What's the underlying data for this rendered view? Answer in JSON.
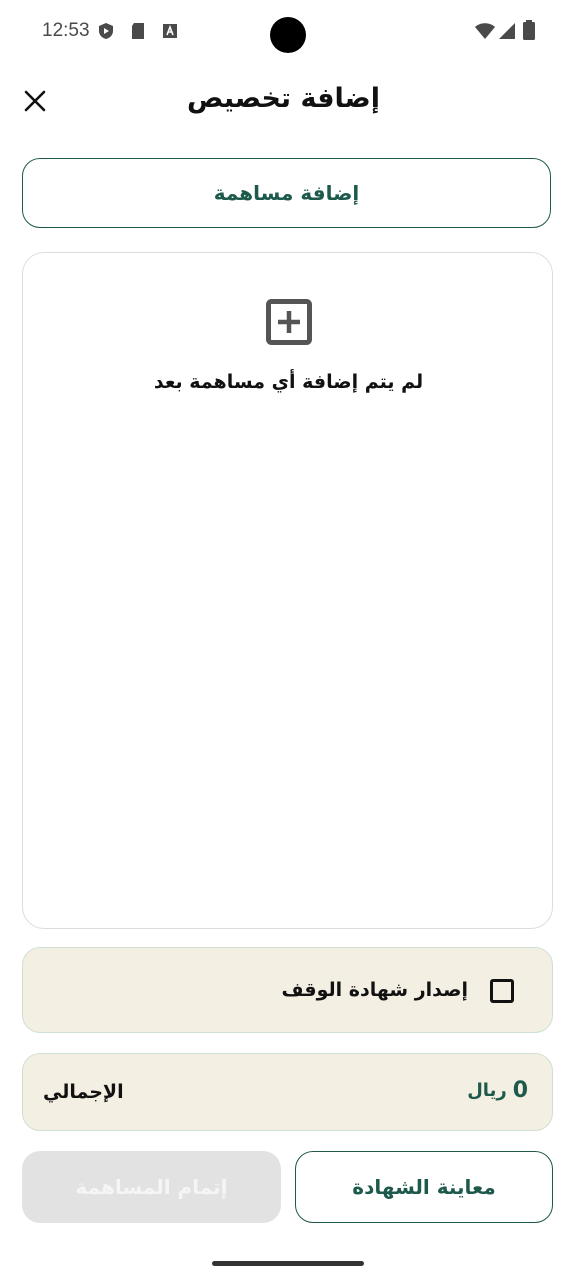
{
  "status_bar": {
    "time": "12:53",
    "icons_left": [
      "shield-play-icon",
      "sd-card-icon",
      "text-a-icon"
    ],
    "icons_right": [
      "wifi-icon",
      "signal-icon",
      "battery-icon"
    ]
  },
  "header": {
    "title": "إضافة تخصيص",
    "close_icon": "close-icon"
  },
  "add_contribution": {
    "label": "إضافة مساهمة"
  },
  "contributions_panel": {
    "empty_icon": "plus-square-icon",
    "empty_text": "لم يتم إضافة أي مساهمة بعد"
  },
  "certificate": {
    "label": "إصدار شهادة الوقف",
    "checked": false
  },
  "total": {
    "label": "الإجمالي",
    "amount": "0",
    "currency": "ريال"
  },
  "actions": {
    "preview_label": "معاينة الشهادة",
    "complete_label": "إتمام المساهمة",
    "complete_enabled": false
  },
  "colors": {
    "primary": "#1d5a4b",
    "panel_bg": "#f4efe3",
    "disabled_bg": "#e2e2e2"
  }
}
